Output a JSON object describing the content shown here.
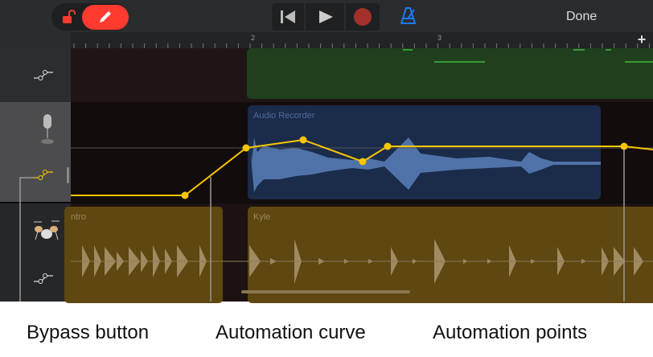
{
  "toolbar": {
    "done_label": "Done"
  },
  "ruler": {
    "markers": [
      "2",
      "3"
    ],
    "add_label": "+"
  },
  "tracks": [
    {
      "name": "keyboard-track",
      "icon": "automation-icon"
    },
    {
      "name": "audio-recorder-track",
      "icon": "microphone-icon",
      "selected": true
    },
    {
      "name": "drums-track",
      "icon": "drum-kit-icon"
    }
  ],
  "regions": {
    "audio": "Audio Recorder",
    "drums_intro": "ntro",
    "drums_kyle": "Kyle"
  },
  "callouts": {
    "bypass": "Bypass button",
    "curve": "Automation curve",
    "points": "Automation points"
  },
  "colors": {
    "accent": "#ff3b30",
    "automation": "#f7c600",
    "metronome": "#1a7cf5",
    "green_region": "#1f3f1d",
    "blue_region": "#1b2b4a",
    "gold_region": "#5e4710"
  }
}
